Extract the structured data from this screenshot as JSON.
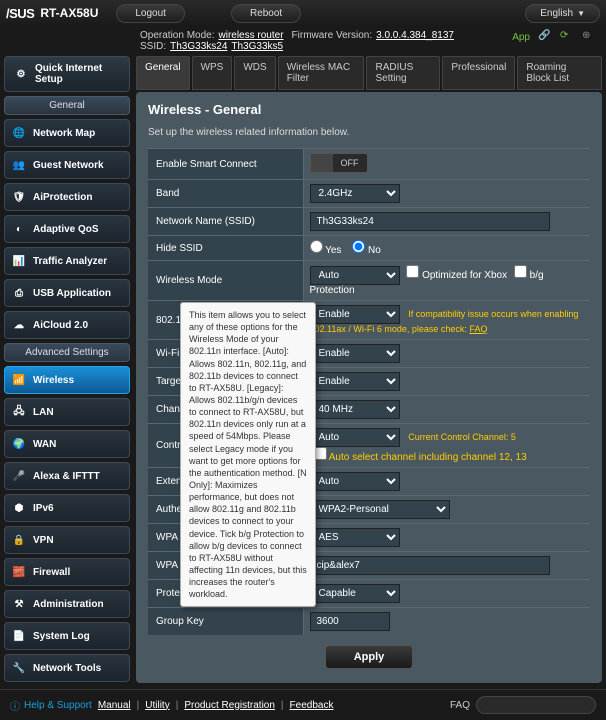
{
  "top": {
    "brand": "/SUS",
    "model": "RT-AX58U",
    "logout": "Logout",
    "reboot": "Reboot",
    "language": "English"
  },
  "info": {
    "op_mode_label": "Operation Mode:",
    "op_mode": "wireless router",
    "fw_label": "Firmware Version:",
    "fw": "3.0.0.4.384_8137",
    "ssid_label": "SSID:",
    "ssid1": "Th3G33ks24",
    "ssid2": "Th3G33ks5",
    "app": "App"
  },
  "qis": "Quick Internet Setup",
  "general_label": "General",
  "advanced_label": "Advanced Settings",
  "nav_general": [
    "Network Map",
    "Guest Network",
    "AiProtection",
    "Adaptive QoS",
    "Traffic Analyzer",
    "USB Application",
    "AiCloud 2.0"
  ],
  "nav_advanced": [
    "Wireless",
    "LAN",
    "WAN",
    "Alexa & IFTTT",
    "IPv6",
    "VPN",
    "Firewall",
    "Administration",
    "System Log",
    "Network Tools"
  ],
  "tabs": [
    "General",
    "WPS",
    "WDS",
    "Wireless MAC Filter",
    "RADIUS Setting",
    "Professional",
    "Roaming Block List"
  ],
  "panel": {
    "title": "Wireless - General",
    "desc": "Set up the wireless related information below."
  },
  "rows": {
    "smart": {
      "label": "Enable Smart Connect",
      "state": "OFF"
    },
    "band": {
      "label": "Band",
      "value": "2.4GHz"
    },
    "ssid": {
      "label": "Network Name (SSID)",
      "value": "Th3G33ks24"
    },
    "hide": {
      "label": "Hide SSID",
      "yes": "Yes",
      "no": "No"
    },
    "mode": {
      "label": "Wireless Mode",
      "value": "Auto",
      "opt1": "Optimized for Xbox",
      "opt2": "b/g Protection"
    },
    "ax": {
      "label": "802.11ax",
      "value": "Enable",
      "hint": "If compatibility issue occurs when enabling 802.11ax / Wi-Fi 6 mode, please check:",
      "faq": "FAQ"
    },
    "agile": {
      "label": "Wi-Fi Agile",
      "value": "Enable"
    },
    "twt": {
      "label": "Target Wake",
      "value": "Enable"
    },
    "chbw": {
      "label": "Channel bandwidth",
      "value": "40 MHz"
    },
    "ctrl": {
      "label": "Control Channel",
      "value": "Auto",
      "hint1": "Current Control Channel: 5",
      "hint2": "Auto select channel including channel 12, 13"
    },
    "ext": {
      "label": "Extension Channel",
      "value": "Auto"
    },
    "auth": {
      "label": "Authentication",
      "value": "WPA2-Personal"
    },
    "enc": {
      "label": "WPA Encryption",
      "value": "AES"
    },
    "psk": {
      "label": "WPA Pre-Shared",
      "value": "cip&alex7"
    },
    "pmf": {
      "label": "Protected Management",
      "value": "Capable"
    },
    "gkey": {
      "label": "Group Key",
      "value": "3600"
    }
  },
  "apply": "Apply",
  "tooltip": "This item allows you to select any of these options for the Wireless Mode of your 802.11n interface.\n[Auto]: Allows 802.11n, 802.11g, and 802.11b devices to connect to RT-AX58U.\n[Legacy]: Allows 802.11b/g/n devices to connect to RT-AX58U, but 802.11n devices only run at a speed of 54Mbps. Please select Legacy mode if you want to get more options for the authentication method.\n[N Only]: Maximizes performance, but does not allow 802.11g and 802.11b devices to connect to your device.\nTick b/g Protection to allow b/g devices to connect to RT-AX58U without affecting 11n devices, but this increases the router's workload.",
  "footer": {
    "help": "Help & Support",
    "links": [
      "Manual",
      "Utility",
      "Product Registration",
      "Feedback"
    ],
    "faq": "FAQ"
  }
}
